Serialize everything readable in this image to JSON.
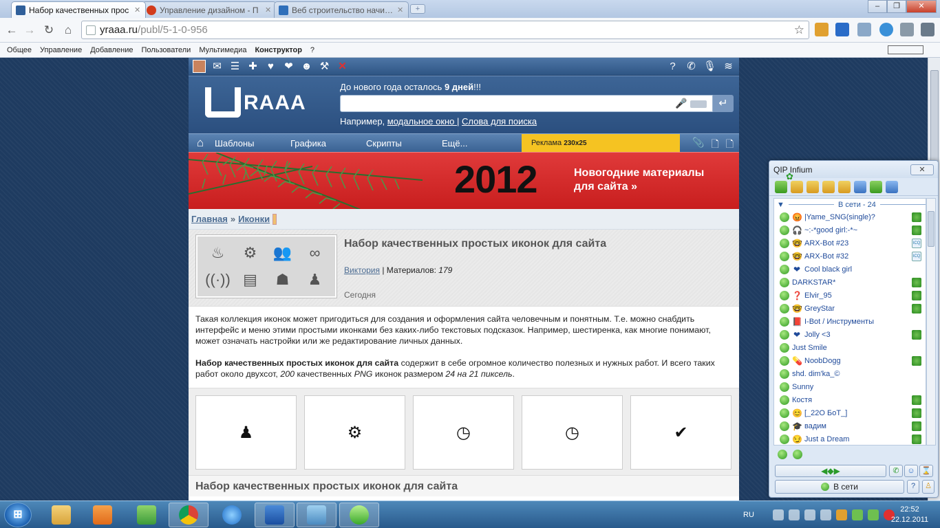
{
  "browser": {
    "tabs": [
      {
        "title": "Набор качественных прос",
        "active": true,
        "favicon_color": "#2f5f9a"
      },
      {
        "title": "Управление дизайном - П",
        "active": false,
        "favicon_color": "#d23b1b"
      },
      {
        "title": "Веб строительство начина",
        "active": false,
        "favicon_color": "#2f6fba"
      }
    ],
    "new_tab_glyph": "+",
    "window_controls": {
      "minimize": "–",
      "maximize": "❐",
      "close": "✕"
    },
    "url_host": "yraaa.ru",
    "url_path": "/publ/5-1-0-956",
    "bookmarks": [
      "Общее",
      "Управление",
      "Добавление",
      "Пользователи",
      "Мультимедиа",
      "Конструктор",
      "?"
    ]
  },
  "site": {
    "countdown_prefix": "До нового года осталось ",
    "countdown_value": "9 дней",
    "countdown_suffix": "!!!",
    "logo_text": "RAAA",
    "search_placeholder": "",
    "hint_prefix": "Например, ",
    "hint_link1": "модальное окно ",
    "hint_sep": "|",
    "hint_link2": "Слова для поиска",
    "menu": [
      "Шаблоны",
      "Графика",
      "Скрипты",
      "Ещё..."
    ],
    "ad_label": "Реклама",
    "ad_size": "230x25",
    "banner_year": "2012",
    "banner_line1": "Новогодние материалы",
    "banner_line2": "для сайта »",
    "crumb1": "Главная",
    "crumb_sep": "»",
    "crumb2": "Иконки",
    "article_title": "Набор качественных простых иконок для сайта",
    "author": "Виктория",
    "materials_label": "| Материалов: ",
    "materials_count": "179",
    "date": "Сегодня",
    "desc1": "Такая коллекция иконок может пригодиться для создания и оформления сайта человечным и понятным. Т.е. можно снабдить интерфейс и меню этими простыми иконками без каких-либо текстовых подсказок. Например, шестиренка, как многие понимают, может означать настройки или же редактирование личных данных.",
    "desc2_bold": "Набор качественных простых иконок для сайта",
    "desc2_a": " содержит в себе огромное количество полезных и нужных работ. И всего таких работ около двухсот, ",
    "desc2_count": "200",
    "desc2_b": " качественных ",
    "desc2_format": "PNG",
    "desc2_c": " иконок размером ",
    "desc2_size": "24 на 21 пиксель",
    "desc2_end": ".",
    "thumb_icons": [
      "fire-icon",
      "gears-icon",
      "users-icon",
      "binoculars-icon",
      "antenna-icon",
      "luggage-icon",
      "agent-icon",
      "user-icon"
    ],
    "gallery": [
      "user-icon",
      "gears-icon",
      "clock-icon",
      "clock-icon",
      "check-icon"
    ],
    "subtitle": "Набор качественных простых иконок для сайта"
  },
  "qip": {
    "title": "QIP Infium",
    "group": "В сети - 24",
    "contacts": [
      {
        "name": "|Yame_SNG(single)?",
        "emoji": "😡",
        "proto": "g"
      },
      {
        "name": "~:-*good girl:-*~",
        "emoji": "🎧",
        "proto": "clover"
      },
      {
        "name": "ARX-Bot #23",
        "emoji": "🤓",
        "proto": "icq"
      },
      {
        "name": "ARX-Bot #32",
        "emoji": "🤓",
        "proto": "icq"
      },
      {
        "name": "Cool black girl",
        "emoji": "❤",
        "proto": ""
      },
      {
        "name": "DARKSTAR*",
        "emoji": "",
        "proto": "g"
      },
      {
        "name": "Elvir_95",
        "emoji": "❓",
        "proto": "g"
      },
      {
        "name": "GreyStar",
        "emoji": "🤓",
        "proto": "g"
      },
      {
        "name": "I-Bot / Инструменты",
        "emoji": "📕",
        "proto": ""
      },
      {
        "name": "Jolly    <3",
        "emoji": "❤",
        "proto": "g"
      },
      {
        "name": "Just Smile",
        "emoji": "",
        "proto": ""
      },
      {
        "name": "NoobDogg",
        "emoji": "💊",
        "proto": "g"
      },
      {
        "name": "shd. dim'ka_©",
        "emoji": "",
        "proto": ""
      },
      {
        "name": "Sunny",
        "emoji": "",
        "proto": ""
      },
      {
        "name": "Костя",
        "emoji": "",
        "proto": "clover"
      },
      {
        "name": "[_22O БоТ_]",
        "emoji": "😊",
        "proto": "g"
      },
      {
        "name": "вадим",
        "emoji": "🎓",
        "proto": "g"
      },
      {
        "name": "Just a Dream",
        "emoji": "😏",
        "proto": "g"
      }
    ],
    "status_label": "В сети"
  },
  "taskbar": {
    "lang": "RU",
    "time": "22:52",
    "date": "22.12.2011"
  }
}
